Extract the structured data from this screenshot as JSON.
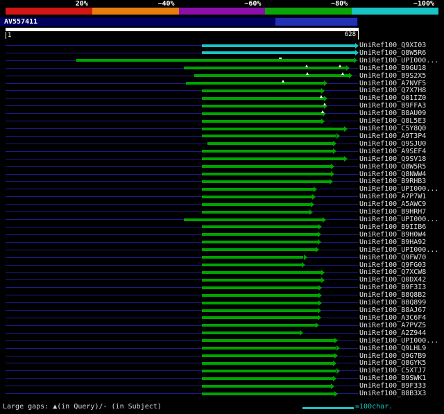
{
  "query": {
    "name": "AV557411",
    "start_label": "1",
    "end_label": "628",
    "length": 628
  },
  "legend": {
    "gaps_label": "Large gaps: ▲(in Query)/- (in Subject)",
    "scale_label": "=100char."
  },
  "colors": {
    "green": "#00a400",
    "cyan": "#18c4c4",
    "query_line": "#1b1b8e"
  },
  "chart_data": {
    "type": "bar",
    "subtype": "horizontal-alignment-span-overview",
    "title": "AV557411",
    "xlabel": "query position",
    "x_range": [
      1,
      628
    ],
    "x_start_label": "1",
    "x_end_label": "628",
    "legend_position": "top",
    "identity_legend": {
      "labels": [
        "20%",
        "~40%",
        "~60%",
        "~80%",
        "~100%"
      ],
      "colors": [
        "#d31616",
        "#e87e0e",
        "#8d10ad",
        "#0ba40b",
        "#18c4c4"
      ]
    },
    "series": [
      {
        "label": "UniRef100_Q9XI03",
        "color": "cyan",
        "start": 350,
        "end": 628
      },
      {
        "label": "UniRef100_Q8W5R6",
        "color": "cyan",
        "start": 350,
        "end": 628
      },
      {
        "label": "UniRef100_UPI000...",
        "color": "green",
        "start": 127,
        "end": 625,
        "subject_gaps": [
          487
        ]
      },
      {
        "label": "UniRef100_B9GU18",
        "color": "green",
        "start": 318,
        "end": 612,
        "query_gaps": [
          534,
          593
        ]
      },
      {
        "label": "UniRef100_B9S2X5",
        "color": "green",
        "start": 337,
        "end": 617,
        "query_gaps": [
          535,
          598
        ]
      },
      {
        "label": "UniRef100_A7NVF5",
        "color": "green",
        "start": 322,
        "end": 573,
        "query_gaps": [
          492
        ]
      },
      {
        "label": "UniRef100_Q7X7H8",
        "color": "green",
        "start": 350,
        "end": 567
      },
      {
        "label": "UniRef100_Q01IZ0",
        "color": "green",
        "start": 350,
        "end": 573,
        "query_gaps": [
          560
        ]
      },
      {
        "label": "UniRef100_B9FFA3",
        "color": "green",
        "start": 350,
        "end": 573,
        "query_gaps": [
          566
        ]
      },
      {
        "label": "UniRef100_B8AU09",
        "color": "green",
        "start": 350,
        "end": 570,
        "query_gaps": [
          562
        ]
      },
      {
        "label": "UniRef100_Q8L5E3",
        "color": "green",
        "start": 350,
        "end": 567
      },
      {
        "label": "UniRef100_C5Y8Q0",
        "color": "green",
        "start": 350,
        "end": 608
      },
      {
        "label": "UniRef100_A9T3P4",
        "color": "green",
        "start": 350,
        "end": 594
      },
      {
        "label": "UniRef100_Q9SJU0",
        "color": "green",
        "start": 360,
        "end": 589
      },
      {
        "label": "UniRef100_A9SEF4",
        "color": "green",
        "start": 350,
        "end": 589
      },
      {
        "label": "UniRef100_Q9SV18",
        "color": "green",
        "start": 350,
        "end": 608
      },
      {
        "label": "UniRef100_Q8W5R5",
        "color": "green",
        "start": 350,
        "end": 585
      },
      {
        "label": "UniRef100_Q8NWW4",
        "color": "green",
        "start": 350,
        "end": 585
      },
      {
        "label": "UniRef100_B9RHB3",
        "color": "green",
        "start": 350,
        "end": 582
      },
      {
        "label": "UniRef100_UPI000...",
        "color": "green",
        "start": 350,
        "end": 554
      },
      {
        "label": "UniRef100_A7P7W1",
        "color": "green",
        "start": 350,
        "end": 551
      },
      {
        "label": "UniRef100_A5AWC9",
        "color": "green",
        "start": 350,
        "end": 549
      },
      {
        "label": "UniRef100_B9HRH7",
        "color": "green",
        "start": 350,
        "end": 546
      },
      {
        "label": "UniRef100_UPI000...",
        "color": "green",
        "start": 318,
        "end": 570
      },
      {
        "label": "UniRef100_B9IIB6",
        "color": "green",
        "start": 350,
        "end": 563
      },
      {
        "label": "UniRef100_B9H0W4",
        "color": "green",
        "start": 350,
        "end": 561
      },
      {
        "label": "UniRef100_B9HA92",
        "color": "green",
        "start": 350,
        "end": 561
      },
      {
        "label": "UniRef100_UPI000...",
        "color": "green",
        "start": 350,
        "end": 558
      },
      {
        "label": "UniRef100_Q9FW70",
        "color": "green",
        "start": 350,
        "end": 536
      },
      {
        "label": "UniRef100_Q9FG03",
        "color": "green",
        "start": 350,
        "end": 533
      },
      {
        "label": "UniRef100_Q7XCW8",
        "color": "green",
        "start": 350,
        "end": 567
      },
      {
        "label": "UniRef100_Q0DX42",
        "color": "green",
        "start": 350,
        "end": 567
      },
      {
        "label": "UniRef100_B9F3I3",
        "color": "green",
        "start": 350,
        "end": 563
      },
      {
        "label": "UniRef100_B8Q8B2",
        "color": "green",
        "start": 350,
        "end": 563
      },
      {
        "label": "UniRef100_B8Q899",
        "color": "green",
        "start": 350,
        "end": 563
      },
      {
        "label": "UniRef100_B8AJ67",
        "color": "green",
        "start": 350,
        "end": 561
      },
      {
        "label": "UniRef100_A3C6F4",
        "color": "green",
        "start": 350,
        "end": 561
      },
      {
        "label": "UniRef100_A7PVZ5",
        "color": "green",
        "start": 350,
        "end": 558
      },
      {
        "label": "UniRef100_A2Z944",
        "color": "green",
        "start": 350,
        "end": 529
      },
      {
        "label": "UniRef100_UPI000...",
        "color": "green",
        "start": 350,
        "end": 591
      },
      {
        "label": "UniRef100_Q9LHL9",
        "color": "green",
        "start": 350,
        "end": 594
      },
      {
        "label": "UniRef100_Q9G7B9",
        "color": "green",
        "start": 350,
        "end": 591
      },
      {
        "label": "UniRef100_Q8GYK5",
        "color": "green",
        "start": 350,
        "end": 589
      },
      {
        "label": "UniRef100_C5XTJ7",
        "color": "green",
        "start": 350,
        "end": 594
      },
      {
        "label": "UniRef100_B9SWK1",
        "color": "green",
        "start": 350,
        "end": 589
      },
      {
        "label": "UniRef100_B9F333",
        "color": "green",
        "start": 350,
        "end": 585
      },
      {
        "label": "UniRef100_B8B3X3",
        "color": "green",
        "start": 350,
        "end": 591
      }
    ]
  }
}
